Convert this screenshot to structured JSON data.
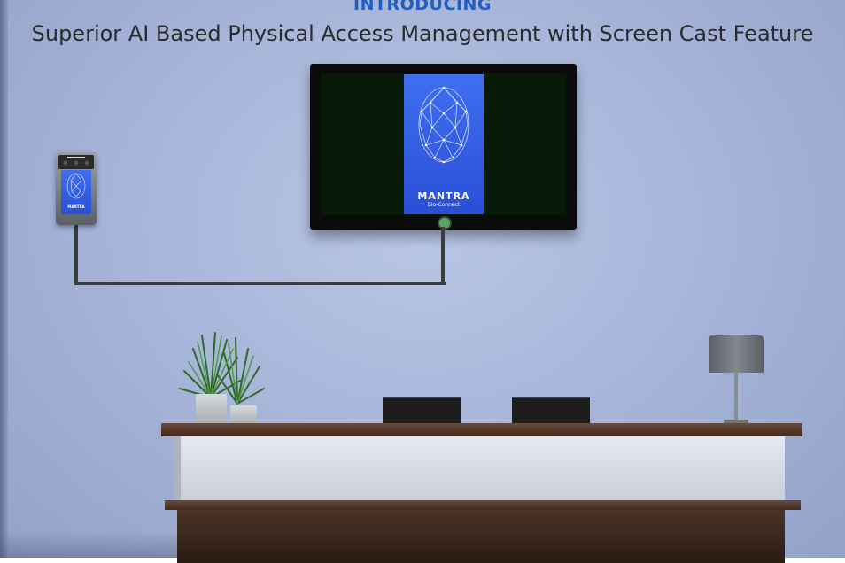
{
  "header": {
    "kicker": "INTRODUCING",
    "tagline": "Superior AI Based Physical Access Management with Screen Cast Feature"
  },
  "tv_screen": {
    "brand": "MANTRA",
    "subbrand": "Bio-Connect"
  },
  "device": {
    "brand": "MANTRA"
  },
  "colors": {
    "kicker": "#1f5fbf",
    "tagline": "#2b2b2b",
    "wall": "#a8b6da",
    "screen_blue": "#3f6ff0",
    "desk_wood": "#4a3326"
  }
}
